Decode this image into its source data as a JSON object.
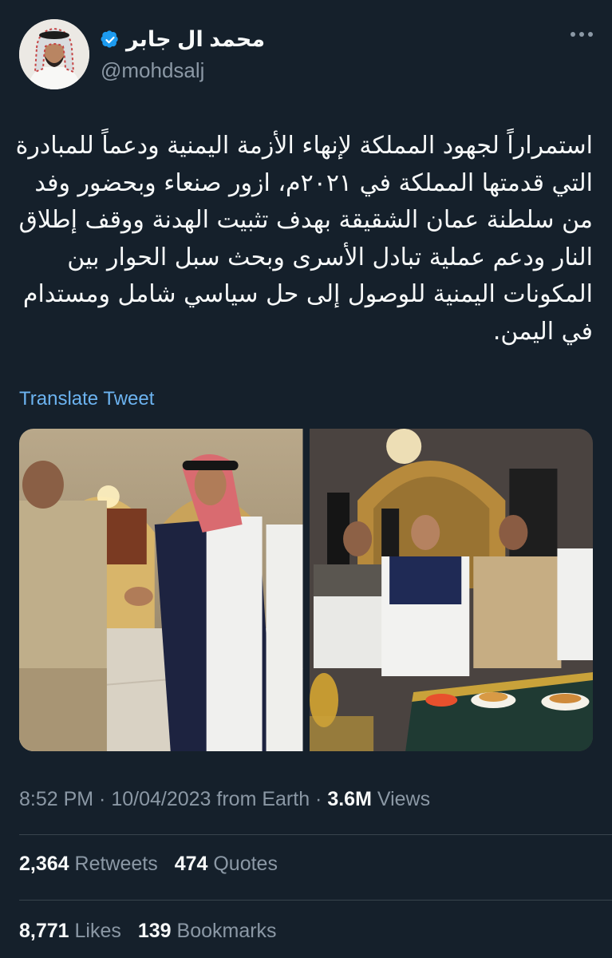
{
  "header": {
    "display_name": "محمد ال جابر",
    "handle": "@mohdsalj"
  },
  "tweet": {
    "text": "استمراراً لجهود المملكة لإنهاء الأزمة اليمنية ودعماً للمبادرة التي قدمتها المملكة في ٢٠٢١م، ازور صنعاء وبحضور وفد من سلطنة عمان الشقيقة بهدف تثبيت الهدنة ووقف إطلاق النار ودعم عملية تبادل الأسرى وبحث سبل الحوار بين المكونات اليمنية للوصول إلى حل سياسي شامل ومستدام في اليمن.",
    "translate_label": "Translate Tweet"
  },
  "meta": {
    "time": "8:52 PM",
    "sep1": " · ",
    "date": "10/04/2023",
    "source": " from Earth",
    "sep2": " · ",
    "views_count": "3.6M",
    "views_label": " Views"
  },
  "stats": {
    "retweets_count": "2,364",
    "retweets_label": "Retweets",
    "quotes_count": "474",
    "quotes_label": "Quotes",
    "likes_count": "8,771",
    "likes_label": "Likes",
    "bookmarks_count": "139",
    "bookmarks_label": "Bookmarks"
  },
  "colors": {
    "background": "#15202b",
    "text": "#f7f9f9",
    "secondary": "#8b98a5",
    "link": "#6cb3f0",
    "verified": "#1d9bf0",
    "divider": "#38444d"
  }
}
